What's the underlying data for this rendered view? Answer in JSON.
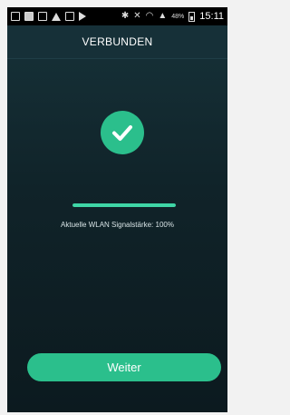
{
  "status_bar": {
    "battery_percent": "48%",
    "time": "15:11"
  },
  "header": {
    "title": "VERBUNDEN"
  },
  "main": {
    "success_icon": "checkmark-circle-icon",
    "signal_progress": 1.0,
    "signal_text": "Aktuelle WLAN Signalstärke: 100%"
  },
  "footer": {
    "continue_label": "Weiter"
  },
  "colors": {
    "accent": "#2bbf8c",
    "progress": "#3fd6a6",
    "background": "#102329"
  }
}
